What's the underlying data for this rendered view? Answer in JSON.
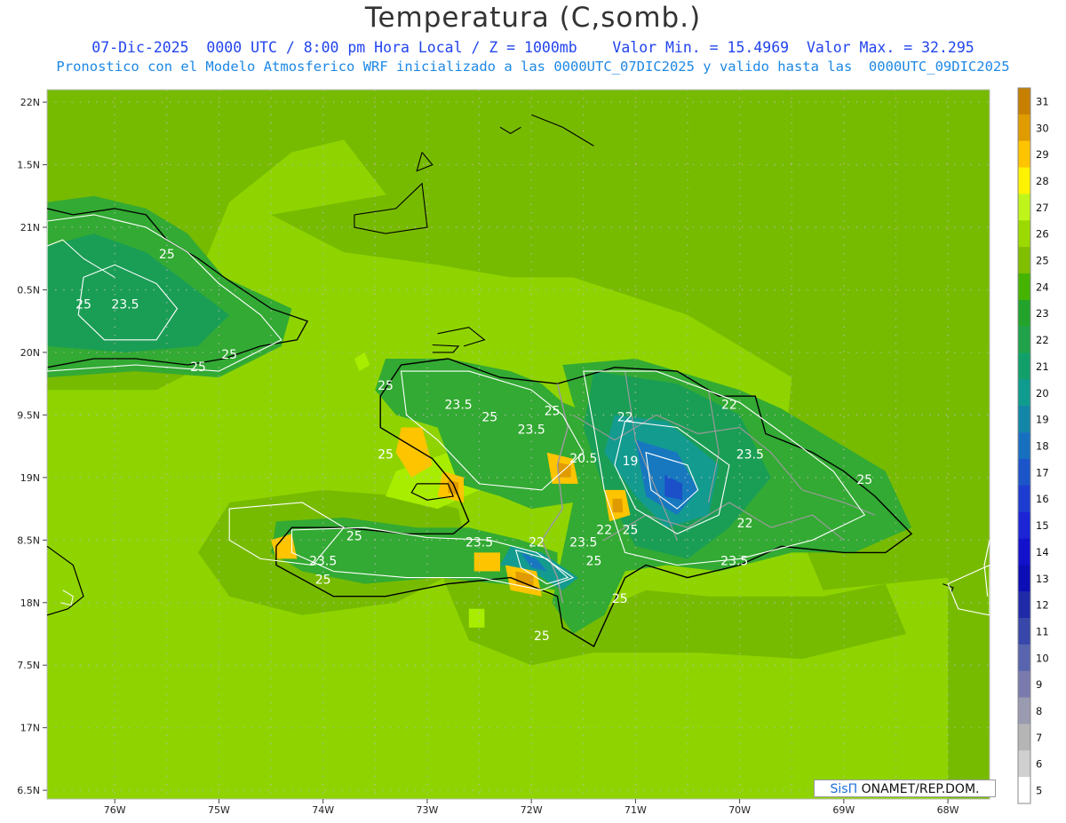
{
  "title": "Temperatura (C,somb.)",
  "subtitle_line1": "07-Dic-2025  0000 UTC / 8:00 pm Hora Local / Z = 1000mb    Valor Min. = 15.4969  Valor Max. = 32.295",
  "subtitle_line2": "Pronostico con el Modelo Atmosferico WRF inicializado a las 0000UTC_07DIC2025 y valido hasta las  0000UTC_09DIC2025",
  "credit": {
    "brand": "SisΠ",
    "text": " ONAMET/REP.DOM."
  },
  "axes": {
    "longitude_labels": [
      "76W",
      "75W",
      "74W",
      "73W",
      "72W",
      "71W",
      "70W",
      "69W",
      "68W"
    ],
    "latitude_labels": [
      "22N",
      "1.5N",
      "21N",
      "0.5N",
      "20N",
      "9.5N",
      "19N",
      "8.5N",
      "18N",
      "7.5N",
      "17N",
      "6.5N"
    ]
  },
  "colorbar": {
    "labels": [
      "31",
      "30",
      "29",
      "28",
      "27",
      "26",
      "25",
      "24",
      "23",
      "22",
      "21",
      "20",
      "19",
      "18",
      "17",
      "16",
      "15",
      "14",
      "13",
      "12",
      "11",
      "10",
      "9",
      "8",
      "7",
      "6",
      "5"
    ],
    "colors": [
      "#c77f00",
      "#e09b00",
      "#ffc400",
      "#fff200",
      "#bff51b",
      "#9bd900",
      "#7fbf00",
      "#44b400",
      "#22a32c",
      "#1fa24a",
      "#12a06a",
      "#109b8f",
      "#1386a8",
      "#1770bf",
      "#1b55c9",
      "#1d3dd0",
      "#1b25d6",
      "#1212cc",
      "#0d0db5",
      "#1f2aa8",
      "#3847a9",
      "#5865ae",
      "#7a7aae",
      "#9a9ab0",
      "#b5b5b5",
      "#d0d0d0",
      "#ffffff"
    ]
  },
  "field": {
    "colors": {
      "ocean": "#8fd400",
      "warm_blob": "#a8ec00",
      "land": "#77bb00",
      "land_cool": "#33aa33",
      "land_cooler": "#1a9e55",
      "land_cold": "#139b8f",
      "highland": "#1778c0",
      "peak": "#1b50c8",
      "hot": "#ffc400",
      "hotter": "#e09b00",
      "hottest": "#c77f00",
      "yellow": "#fff200"
    },
    "contour_labels": [
      {
        "text": "25",
        "lon": -75.5,
        "lat": 20.75
      },
      {
        "text": "25",
        "lon": -76.3,
        "lat": 20.35
      },
      {
        "text": "23.5",
        "lon": -75.9,
        "lat": 20.35
      },
      {
        "text": "25",
        "lon": -75.2,
        "lat": 19.85
      },
      {
        "text": "25",
        "lon": -74.9,
        "lat": 19.95
      },
      {
        "text": "25",
        "lon": -73.4,
        "lat": 19.7
      },
      {
        "text": "23.5",
        "lon": -72.7,
        "lat": 19.55
      },
      {
        "text": "25",
        "lon": -72.4,
        "lat": 19.45
      },
      {
        "text": "23.5",
        "lon": -72.0,
        "lat": 19.35
      },
      {
        "text": "22",
        "lon": -71.1,
        "lat": 19.45
      },
      {
        "text": "22",
        "lon": -70.1,
        "lat": 19.55
      },
      {
        "text": "23.5",
        "lon": -69.9,
        "lat": 19.15
      },
      {
        "text": "25",
        "lon": -71.8,
        "lat": 19.5
      },
      {
        "text": "20.5",
        "lon": -71.5,
        "lat": 19.12
      },
      {
        "text": "19",
        "lon": -71.05,
        "lat": 19.1
      },
      {
        "text": "25",
        "lon": -73.4,
        "lat": 19.15
      },
      {
        "text": "25",
        "lon": -68.8,
        "lat": 18.95
      },
      {
        "text": "22",
        "lon": -71.3,
        "lat": 18.55
      },
      {
        "text": "25",
        "lon": -71.05,
        "lat": 18.55
      },
      {
        "text": "22",
        "lon": -69.95,
        "lat": 18.6
      },
      {
        "text": "25",
        "lon": -73.7,
        "lat": 18.5
      },
      {
        "text": "23.5",
        "lon": -72.5,
        "lat": 18.45
      },
      {
        "text": "22",
        "lon": -71.95,
        "lat": 18.45
      },
      {
        "text": "23.5",
        "lon": -71.5,
        "lat": 18.45
      },
      {
        "text": "25",
        "lon": -71.4,
        "lat": 18.3
      },
      {
        "text": "23.5",
        "lon": -70.05,
        "lat": 18.3
      },
      {
        "text": "23.5",
        "lon": -74.0,
        "lat": 18.3
      },
      {
        "text": "25",
        "lon": -74.0,
        "lat": 18.15
      },
      {
        "text": "25",
        "lon": -71.15,
        "lat": 18.0
      },
      {
        "text": "25",
        "lon": -71.9,
        "lat": 17.7
      }
    ]
  }
}
